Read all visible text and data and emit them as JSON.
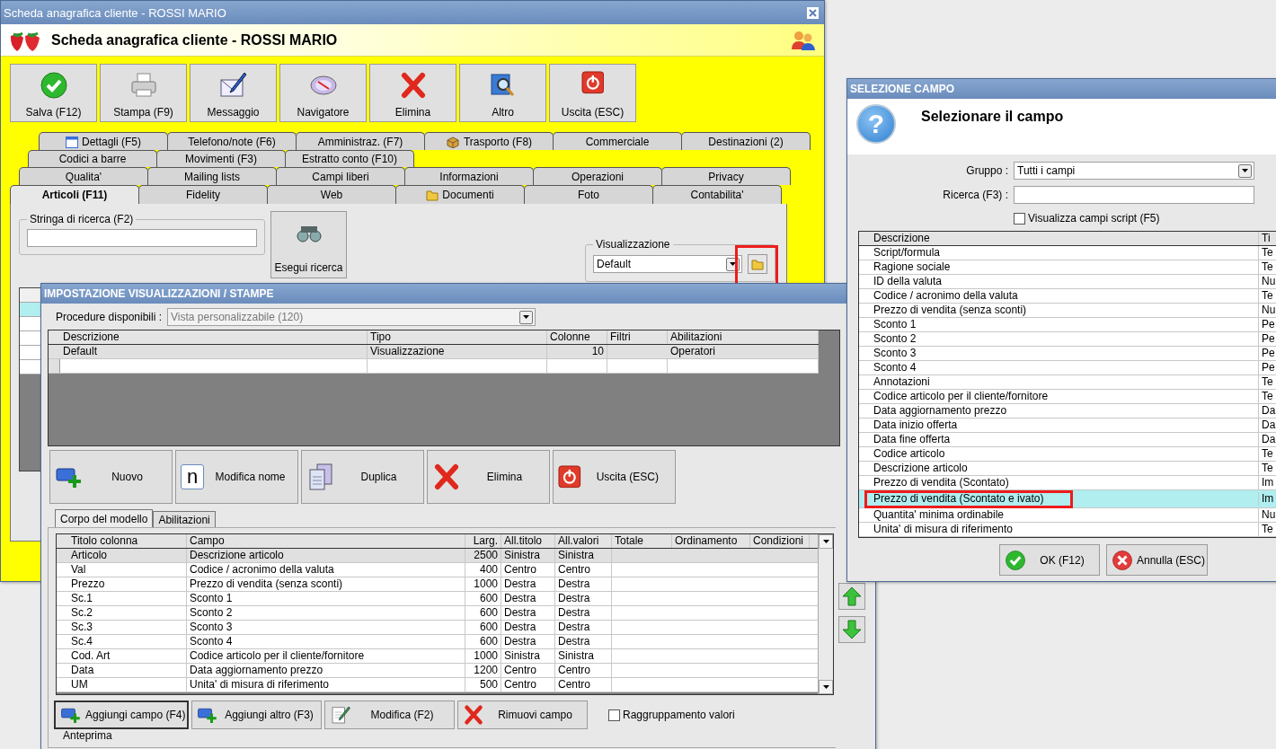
{
  "main_window": {
    "title": "Scheda anagrafica cliente - ROSSI MARIO",
    "heading": "Scheda anagrafica cliente - ROSSI MARIO",
    "toolbar": [
      {
        "kind": "save",
        "label": "Salva (F12)"
      },
      {
        "kind": "print",
        "label": "Stampa (F9)"
      },
      {
        "kind": "message",
        "label": "Messaggio"
      },
      {
        "kind": "navigator",
        "label": "Navigatore"
      },
      {
        "kind": "delete",
        "label": "Elimina"
      },
      {
        "kind": "other",
        "label": "Altro"
      },
      {
        "kind": "exit",
        "label": "Uscita (ESC)"
      }
    ],
    "tab_rows": [
      [
        {
          "label": "Dettagli (F5)",
          "kind": "calendar",
          "selected": false
        },
        {
          "label": "Telefono/note (F6)",
          "kind": "plain",
          "selected": false
        },
        {
          "label": "Amministraz. (F7)",
          "kind": "plain",
          "selected": false
        },
        {
          "label": "Trasporto (F8)",
          "kind": "parcel",
          "selected": false
        },
        {
          "label": "Commerciale",
          "kind": "plain",
          "selected": false
        },
        {
          "label": "Destinazioni (2)",
          "kind": "plain",
          "selected": false
        }
      ],
      [
        {
          "label": "Codici a barre",
          "kind": "plain",
          "selected": false
        },
        {
          "label": "Movimenti (F3)",
          "kind": "plain",
          "selected": false
        },
        {
          "label": "Estratto conto (F10)",
          "kind": "plain",
          "selected": false
        }
      ],
      [
        {
          "label": "Qualita'",
          "kind": "plain",
          "selected": false
        },
        {
          "label": "Mailing lists",
          "kind": "plain",
          "selected": false
        },
        {
          "label": "Campi liberi",
          "kind": "plain",
          "selected": false
        },
        {
          "label": "Informazioni",
          "kind": "plain",
          "selected": false
        },
        {
          "label": "Operazioni",
          "kind": "plain",
          "selected": false
        },
        {
          "label": "Privacy",
          "kind": "plain",
          "selected": false
        }
      ],
      [
        {
          "label": "Articoli (F11)",
          "kind": "plain",
          "selected": true
        },
        {
          "label": "Fidelity",
          "kind": "plain",
          "selected": false
        },
        {
          "label": "Web",
          "kind": "plain",
          "selected": false
        },
        {
          "label": "Documenti",
          "kind": "folder",
          "selected": false
        },
        {
          "label": "Foto",
          "kind": "plain",
          "selected": false
        },
        {
          "label": "Contabilita'",
          "kind": "plain",
          "selected": false
        }
      ]
    ],
    "search_group": {
      "label": "Stringa di ricerca (F2)"
    },
    "search_button": {
      "label": "Esegui ricerca"
    },
    "view_group": {
      "label": "Visualizzazione",
      "value": "Default",
      "folder_highlighted": true
    }
  },
  "layout_dialog": {
    "title": "IMPOSTAZIONE VISUALIZZAZIONI / STAMPE",
    "procedure": {
      "label": "Procedure disponibili :",
      "value": "Vista personalizzabile (120)",
      "disabled": true
    },
    "views_table": {
      "columns": [
        "Descrizione",
        "Tipo",
        "Colonne",
        "Filtri",
        "Abilitazioni"
      ],
      "rows": [
        {
          "cells": [
            "Default",
            "Visualizzazione",
            "10",
            "",
            "Operatori"
          ],
          "selected": true
        }
      ]
    },
    "buttons": [
      {
        "kind": "new",
        "label": "Nuovo"
      },
      {
        "kind": "rename",
        "label": "Modifica nome",
        "icon_text": "n"
      },
      {
        "kind": "duplicate",
        "label": "Duplica"
      },
      {
        "kind": "delete",
        "label": "Elimina"
      },
      {
        "kind": "exit",
        "label": "Uscita (ESC)"
      }
    ],
    "tabs": [
      {
        "label": "Corpo del modello",
        "selected": true
      },
      {
        "label": "Abilitazioni",
        "selected": false
      }
    ],
    "fields_table": {
      "columns": [
        "Titolo colonna",
        "Campo",
        "Larg.",
        "All.titolo",
        "All.valori",
        "Totale",
        "Ordinamento",
        "Condizioni"
      ],
      "rows": [
        {
          "cells": [
            "Articolo",
            "Descrizione articolo",
            "2500",
            "Sinistra",
            "Sinistra"
          ],
          "selected": true
        },
        {
          "cells": [
            "Val",
            "Codice / acronimo della valuta",
            "400",
            "Centro",
            "Centro"
          ],
          "selected": false
        },
        {
          "cells": [
            "Prezzo",
            "Prezzo di vendita (senza sconti)",
            "1000",
            "Destra",
            "Destra"
          ],
          "selected": false
        },
        {
          "cells": [
            "Sc.1",
            "Sconto 1",
            "600",
            "Destra",
            "Destra"
          ],
          "selected": false
        },
        {
          "cells": [
            "Sc.2",
            "Sconto 2",
            "600",
            "Destra",
            "Destra"
          ],
          "selected": false
        },
        {
          "cells": [
            "Sc.3",
            "Sconto 3",
            "600",
            "Destra",
            "Destra"
          ],
          "selected": false
        },
        {
          "cells": [
            "Sc.4",
            "Sconto 4",
            "600",
            "Destra",
            "Destra"
          ],
          "selected": false
        },
        {
          "cells": [
            "Cod. Art",
            "Codice articolo per il cliente/fornitore",
            "1000",
            "Sinistra",
            "Sinistra"
          ],
          "selected": false
        },
        {
          "cells": [
            "Data",
            "Data aggiornamento prezzo",
            "1200",
            "Centro",
            "Centro"
          ],
          "selected": false
        },
        {
          "cells": [
            "UM",
            "Unita' di misura di riferimento",
            "500",
            "Centro",
            "Centro"
          ],
          "selected": false
        }
      ]
    },
    "field_buttons": [
      {
        "kind": "add",
        "label": "Aggiungi campo (F4)",
        "focused": true
      },
      {
        "kind": "add",
        "label": "Aggiungi altro (F3)",
        "focused": false
      },
      {
        "kind": "edit",
        "label": "Modifica (F2)",
        "focused": false
      },
      {
        "kind": "remove",
        "label": "Rimuovi campo",
        "focused": false
      }
    ],
    "grouping_checkbox": {
      "label": "Raggruppamento valori",
      "checked": false
    },
    "preview_label": "Anteprima"
  },
  "field_dialog": {
    "title": "SELEZIONE CAMPO",
    "heading": "Selezionare il campo",
    "icon_text": "?",
    "group": {
      "label": "Gruppo :",
      "value": "Tutti i campi"
    },
    "search": {
      "label": "Ricerca (F3) :"
    },
    "script_checkbox": {
      "label": "Visualizza campi script (F5)",
      "checked": false
    },
    "table": {
      "columns": [
        "Descrizione",
        "Ti"
      ],
      "rows": [
        {
          "cells": [
            "Script/formula",
            "Te"
          ],
          "selected": false,
          "highlighted": false
        },
        {
          "cells": [
            "Ragione sociale",
            "Te"
          ],
          "selected": false,
          "highlighted": false
        },
        {
          "cells": [
            "ID della valuta",
            "Nu"
          ],
          "selected": false,
          "highlighted": false
        },
        {
          "cells": [
            "Codice / acronimo della valuta",
            "Te"
          ],
          "selected": false,
          "highlighted": false
        },
        {
          "cells": [
            "Prezzo di vendita (senza sconti)",
            "Nu"
          ],
          "selected": false,
          "highlighted": false
        },
        {
          "cells": [
            "Sconto 1",
            "Pe"
          ],
          "selected": false,
          "highlighted": false
        },
        {
          "cells": [
            "Sconto 2",
            "Pe"
          ],
          "selected": false,
          "highlighted": false
        },
        {
          "cells": [
            "Sconto 3",
            "Pe"
          ],
          "selected": false,
          "highlighted": false
        },
        {
          "cells": [
            "Sconto 4",
            "Pe"
          ],
          "selected": false,
          "highlighted": false
        },
        {
          "cells": [
            "Annotazioni",
            "Te"
          ],
          "selected": false,
          "highlighted": false
        },
        {
          "cells": [
            "Codice articolo per il cliente/fornitore",
            "Te"
          ],
          "selected": false,
          "highlighted": false
        },
        {
          "cells": [
            "Data aggiornamento prezzo",
            "Da"
          ],
          "selected": false,
          "highlighted": false
        },
        {
          "cells": [
            "Data inizio offerta",
            "Da"
          ],
          "selected": false,
          "highlighted": false
        },
        {
          "cells": [
            "Data fine offerta",
            "Da"
          ],
          "selected": false,
          "highlighted": false
        },
        {
          "cells": [
            "Codice articolo",
            "Te"
          ],
          "selected": false,
          "highlighted": false
        },
        {
          "cells": [
            "Descrizione articolo",
            "Te"
          ],
          "selected": false,
          "highlighted": false
        },
        {
          "cells": [
            "Prezzo di vendita (Scontato)",
            "Im"
          ],
          "selected": false,
          "highlighted": false
        },
        {
          "cells": [
            "Prezzo di vendita (Scontato e ivato)",
            "Im"
          ],
          "selected": true,
          "highlighted": true
        },
        {
          "cells": [
            "Quantita' minima ordinabile",
            "Nu"
          ],
          "selected": false,
          "highlighted": false
        },
        {
          "cells": [
            "Unita' di misura di riferimento",
            "Te"
          ],
          "selected": false,
          "highlighted": false
        }
      ]
    },
    "buttons": [
      {
        "kind": "ok",
        "label": "OK (F12)"
      },
      {
        "kind": "cancel",
        "label": "Annulla (ESC)"
      }
    ]
  }
}
